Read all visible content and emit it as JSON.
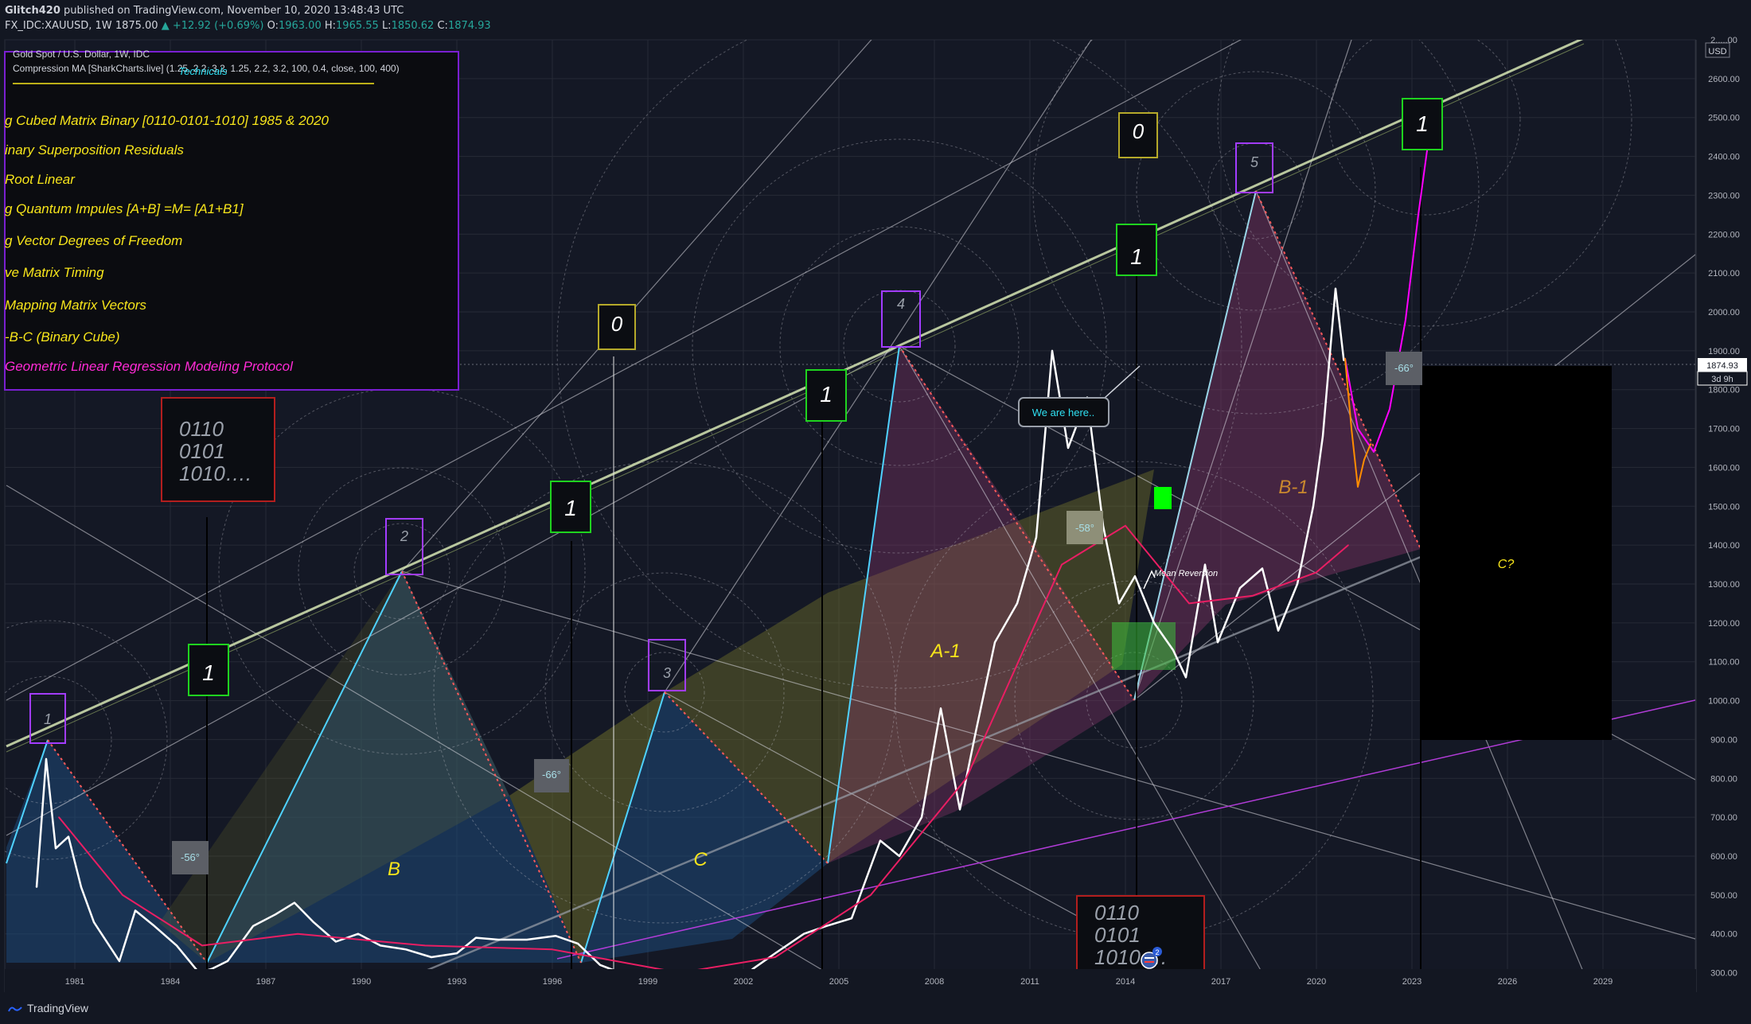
{
  "header": {
    "author": "Glitch420",
    "published": "published on TradingView.com, November 10, 2020 13:48:43 UTC",
    "symbol": "FX_IDC:XAUUSD, 1W",
    "last": "1875.00",
    "change": "▲ +12.92 (+0.69%)",
    "o_label": "O:",
    "o_val": "1963.00",
    "h_label": "H:",
    "h_val": "1965.55",
    "l_label": "L:",
    "l_val": "1850.62",
    "c_label": "C:",
    "c_val": "1874.93"
  },
  "legend": {
    "instrument": "Gold Spot / U.S. Dollar, 1W, IDC",
    "indicator": "Compression MA [SharkCharts.live] (1.25, 2.2, 3.2, 1.25, 2.2, 3.2, 100, 0.4, close, 100, 400)",
    "technicals": "Technicals",
    "items": [
      "g Cubed Matrix Binary [0110-0101-1010]  1985 & 2020",
      "inary Superposition Residuals",
      "Root Linear",
      "g Quantum Impules [A+B] =M= [A1+B1]",
      "g Vector Degrees of Freedom",
      "ve Matrix Timing",
      " Mapping Matrix Vectors",
      "-B-C  (Binary Cube)",
      "Geometric Linear Regression Modeling Protocol"
    ]
  },
  "binary_box_top": [
    "0110",
    "0101",
    "1010…."
  ],
  "binary_box_bottom": [
    "0110",
    "0101",
    "1010…."
  ],
  "labels": {
    "we_are_here": "We are here..",
    "mean_reversion": "Mean Reversion",
    "wave_b": "B",
    "wave_c": "C",
    "wave_a1": "A-1",
    "wave_b1": "B-1",
    "wave_c_q": "C?",
    "angle_56": "-56°",
    "angle_66": "-66°",
    "angle_58": "-58°",
    "angle_66b": "-66°"
  },
  "cube_markers": [
    "1",
    "2",
    "3",
    "4",
    "5"
  ],
  "green_markers": [
    "1",
    "1",
    "1",
    "1",
    "1"
  ],
  "yellow_markers": [
    "0",
    "0"
  ],
  "price_axis": {
    "currency": "USD",
    "current_price": "1874.93",
    "countdown": "3d 9h",
    "accent_color": "#ffffff"
  },
  "footer": {
    "brand": "TradingView"
  },
  "chart_data": {
    "type": "line",
    "title": "Gold Spot / U.S. Dollar, 1W, IDC",
    "xlabel": "",
    "ylabel": "",
    "x_ticks": [
      "1981",
      "1984",
      "1987",
      "1990",
      "1993",
      "1996",
      "1999",
      "2002",
      "2005",
      "2008",
      "2011",
      "2014",
      "2017",
      "2020",
      "2023",
      "2026",
      "2029"
    ],
    "y_ticks": [
      "300.00",
      "400.00",
      "500.00",
      "600.00",
      "700.00",
      "800.00",
      "900.00",
      "1000.00",
      "1100.00",
      "1200.00",
      "1300.00",
      "1400.00",
      "1500.00",
      "1600.00",
      "1700.00",
      "1800.00",
      "1900.00",
      "2000.00",
      "2100.00",
      "2200.00",
      "2300.00",
      "2400.00",
      "2500.00",
      "2600.00",
      "2.....00"
    ],
    "ylim": [
      250,
      2700
    ],
    "xlim": [
      1978.8,
      2031.9
    ],
    "series": [
      {
        "name": "XAUUSD",
        "color": "#ffffff",
        "points": [
          [
            1979.8,
            520
          ],
          [
            1980.1,
            850
          ],
          [
            1980.4,
            620
          ],
          [
            1980.8,
            650
          ],
          [
            1981.2,
            520
          ],
          [
            1981.6,
            430
          ],
          [
            1982.4,
            330
          ],
          [
            1982.9,
            460
          ],
          [
            1983.5,
            420
          ],
          [
            1984.2,
            370
          ],
          [
            1984.9,
            300
          ],
          [
            1985.3,
            310
          ],
          [
            1985.8,
            330
          ],
          [
            1986.6,
            420
          ],
          [
            1987.3,
            450
          ],
          [
            1987.9,
            480
          ],
          [
            1988.5,
            430
          ],
          [
            1989.2,
            380
          ],
          [
            1989.9,
            400
          ],
          [
            1990.6,
            370
          ],
          [
            1991.4,
            360
          ],
          [
            1992.2,
            340
          ],
          [
            1993.0,
            350
          ],
          [
            1993.6,
            390
          ],
          [
            1994.3,
            385
          ],
          [
            1995.2,
            385
          ],
          [
            1996.1,
            395
          ],
          [
            1996.8,
            375
          ],
          [
            1997.5,
            320
          ],
          [
            1998.3,
            295
          ],
          [
            1999.1,
            280
          ],
          [
            1999.7,
            265
          ],
          [
            2000.3,
            290
          ],
          [
            2001.0,
            270
          ],
          [
            2001.6,
            265
          ],
          [
            2002.3,
            310
          ],
          [
            2003.0,
            350
          ],
          [
            2003.9,
            400
          ],
          [
            2004.6,
            420
          ],
          [
            2005.4,
            440
          ],
          [
            2006.3,
            640
          ],
          [
            2006.9,
            600
          ],
          [
            2007.6,
            700
          ],
          [
            2008.2,
            980
          ],
          [
            2008.8,
            720
          ],
          [
            2009.3,
            920
          ],
          [
            2009.9,
            1150
          ],
          [
            2010.6,
            1250
          ],
          [
            2011.2,
            1420
          ],
          [
            2011.7,
            1900
          ],
          [
            2012.2,
            1650
          ],
          [
            2012.8,
            1780
          ],
          [
            2013.3,
            1450
          ],
          [
            2013.8,
            1250
          ],
          [
            2014.3,
            1320
          ],
          [
            2014.9,
            1200
          ],
          [
            2015.5,
            1130
          ],
          [
            2015.9,
            1060
          ],
          [
            2016.5,
            1350
          ],
          [
            2016.9,
            1150
          ],
          [
            2017.6,
            1290
          ],
          [
            2018.3,
            1340
          ],
          [
            2018.8,
            1180
          ],
          [
            2019.4,
            1300
          ],
          [
            2019.9,
            1500
          ],
          [
            2020.2,
            1680
          ],
          [
            2020.6,
            2060
          ],
          [
            2020.86,
            1875
          ]
        ]
      },
      {
        "name": "Projection",
        "color": "#ff00ff",
        "points": [
          [
            2020.9,
            1880
          ],
          [
            2021.3,
            1700
          ],
          [
            2021.8,
            1640
          ],
          [
            2022.3,
            1750
          ],
          [
            2022.8,
            1980
          ],
          [
            2023.2,
            2250
          ],
          [
            2023.5,
            2430
          ]
        ]
      },
      {
        "name": "Projection (retrace)",
        "color": "#ff8c00",
        "points": [
          [
            2020.9,
            1880
          ],
          [
            2021.1,
            1700
          ],
          [
            2021.3,
            1550
          ],
          [
            2021.5,
            1620
          ],
          [
            2021.7,
            1660
          ]
        ]
      },
      {
        "name": "Compression MA",
        "color": "#e91e63",
        "points": [
          [
            1980.5,
            700
          ],
          [
            1982.5,
            500
          ],
          [
            1985,
            370
          ],
          [
            1988,
            400
          ],
          [
            1992,
            370
          ],
          [
            1996,
            360
          ],
          [
            2000,
            300
          ],
          [
            2003,
            340
          ],
          [
            2006,
            500
          ],
          [
            2009,
            800
          ],
          [
            2012,
            1350
          ],
          [
            2014,
            1450
          ],
          [
            2016,
            1250
          ],
          [
            2018,
            1270
          ],
          [
            2020,
            1330
          ],
          [
            2021,
            1400
          ]
        ]
      }
    ]
  }
}
